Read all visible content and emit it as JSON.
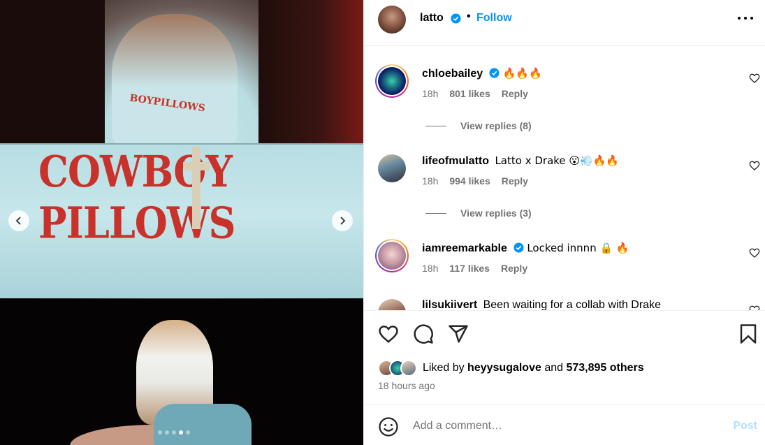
{
  "post": {
    "author": "latto",
    "follow_label": "Follow",
    "separator": "•",
    "carousel": {
      "total": 5,
      "active_index": 3
    },
    "media_text": {
      "shirt_print": "COWBOY PILLOWS",
      "shirt_print_small": "BOYPILLOWS"
    }
  },
  "comments": [
    {
      "username": "chloebailey",
      "verified": true,
      "text": "🔥🔥🔥",
      "time": "18h",
      "likes": "801 likes",
      "reply": "Reply",
      "replies": "View replies (8)",
      "avatar": "blue-green"
    },
    {
      "username": "lifeofmulatto",
      "verified": false,
      "text": "Latto x Drake 😮💨🔥🔥",
      "time": "18h",
      "likes": "994 likes",
      "reply": "Reply",
      "replies": "View replies (3)",
      "avatar": "person"
    },
    {
      "username": "iamreemarkable",
      "verified": true,
      "text": "Locked innnn 🔒 🔥",
      "time": "18h",
      "likes": "117 likes",
      "reply": "Reply",
      "avatar": "face"
    },
    {
      "username": "lilsukiivert",
      "verified": false,
      "text": "Been waiting for a collab with Drake",
      "avatar": "person-hat"
    }
  ],
  "engagement": {
    "liked_by_prefix": "Liked by",
    "liked_by_user": "heyysugalove",
    "liked_by_and": "and",
    "others": "573,895 others",
    "time_ago": "18 hours ago"
  },
  "add_comment": {
    "placeholder": "Add a comment…",
    "post_label": "Post"
  },
  "colors": {
    "accent": "#0095f6",
    "post_disabled": "#b2dffc",
    "muted": "#737373",
    "verified": "#0095f6"
  }
}
